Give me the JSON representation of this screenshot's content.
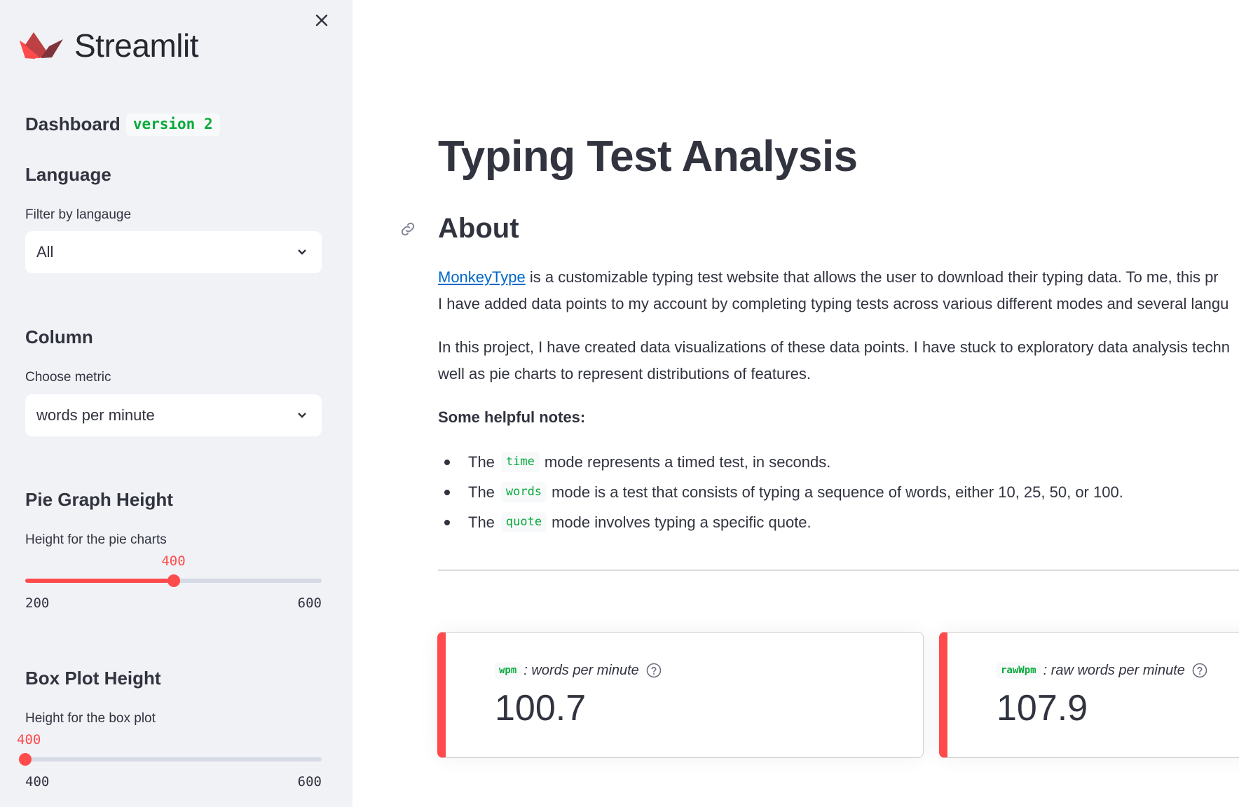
{
  "sidebar": {
    "logo_text": "Streamlit",
    "close_icon": "close-icon",
    "dashboard_heading": "Dashboard",
    "version_badge": "version 2",
    "language": {
      "heading": "Language",
      "label": "Filter by langauge",
      "selected": "All"
    },
    "column": {
      "heading": "Column",
      "label": "Choose metric",
      "selected": "words per minute"
    },
    "pie_height": {
      "heading": "Pie Graph Height",
      "label": "Height for the pie charts",
      "value": 400,
      "value_label": "400",
      "min": 200,
      "max": 600,
      "min_label": "200",
      "max_label": "600"
    },
    "box_height": {
      "heading": "Box Plot Height",
      "label": "Height for the box plot",
      "value": 400,
      "value_label": "400",
      "min": 400,
      "max": 600,
      "min_label": "400",
      "max_label": "600"
    }
  },
  "main": {
    "title": "Typing Test Analysis",
    "about_heading": "About",
    "para1_link": "MonkeyType",
    "para1_line1_rest": " is a customizable typing test website that allows the user to download their typing data. To me, this pr",
    "para1_line2": "I have added data points to my account by completing typing tests across various different modes and several langu",
    "para2_line1": "In this project, I have created data visualizations of these data points. I have stuck to exploratory data analysis techn",
    "para2_line2": "well as pie charts to represent distributions of features.",
    "notes_heading": "Some helpful notes:",
    "notes": [
      {
        "prefix": "The",
        "code": "time",
        "text": "mode represents a timed test, in seconds."
      },
      {
        "prefix": "The",
        "code": "words",
        "text": "mode is a test that consists of typing a sequence of words, either 10, 25, 50, or 100."
      },
      {
        "prefix": "The",
        "code": "quote",
        "text": "mode involves typing a specific quote."
      }
    ],
    "metrics": [
      {
        "code": "wpm",
        "label": ": words per minute",
        "value": "100.7"
      },
      {
        "code": "rawWpm",
        "label": ": raw words per minute",
        "value": "107.9"
      }
    ]
  },
  "colors": {
    "accent": "#ff4b4b",
    "code_green": "#09ab3b",
    "link": "#0068c9",
    "sidebar_bg": "#f0f2f6"
  }
}
